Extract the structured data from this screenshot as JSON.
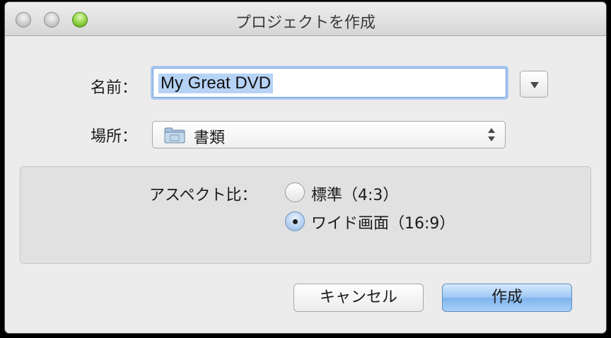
{
  "window": {
    "title": "プロジェクトを作成"
  },
  "form": {
    "name_label": "名前：",
    "name_value": "My Great DVD",
    "location_label": "場所：",
    "location_value": "書類",
    "aspect_label": "アスペクト比：",
    "aspect_options": [
      {
        "label": "標準（4:3）",
        "selected": false
      },
      {
        "label": "ワイド画面（16:9）",
        "selected": true
      }
    ]
  },
  "buttons": {
    "cancel": "キャンセル",
    "create": "作成"
  },
  "icons": {
    "name_dropdown": "triangle-down-icon",
    "location_folder": "folder-icon",
    "location_popup_arrows": "up-down-arrows-icon"
  }
}
